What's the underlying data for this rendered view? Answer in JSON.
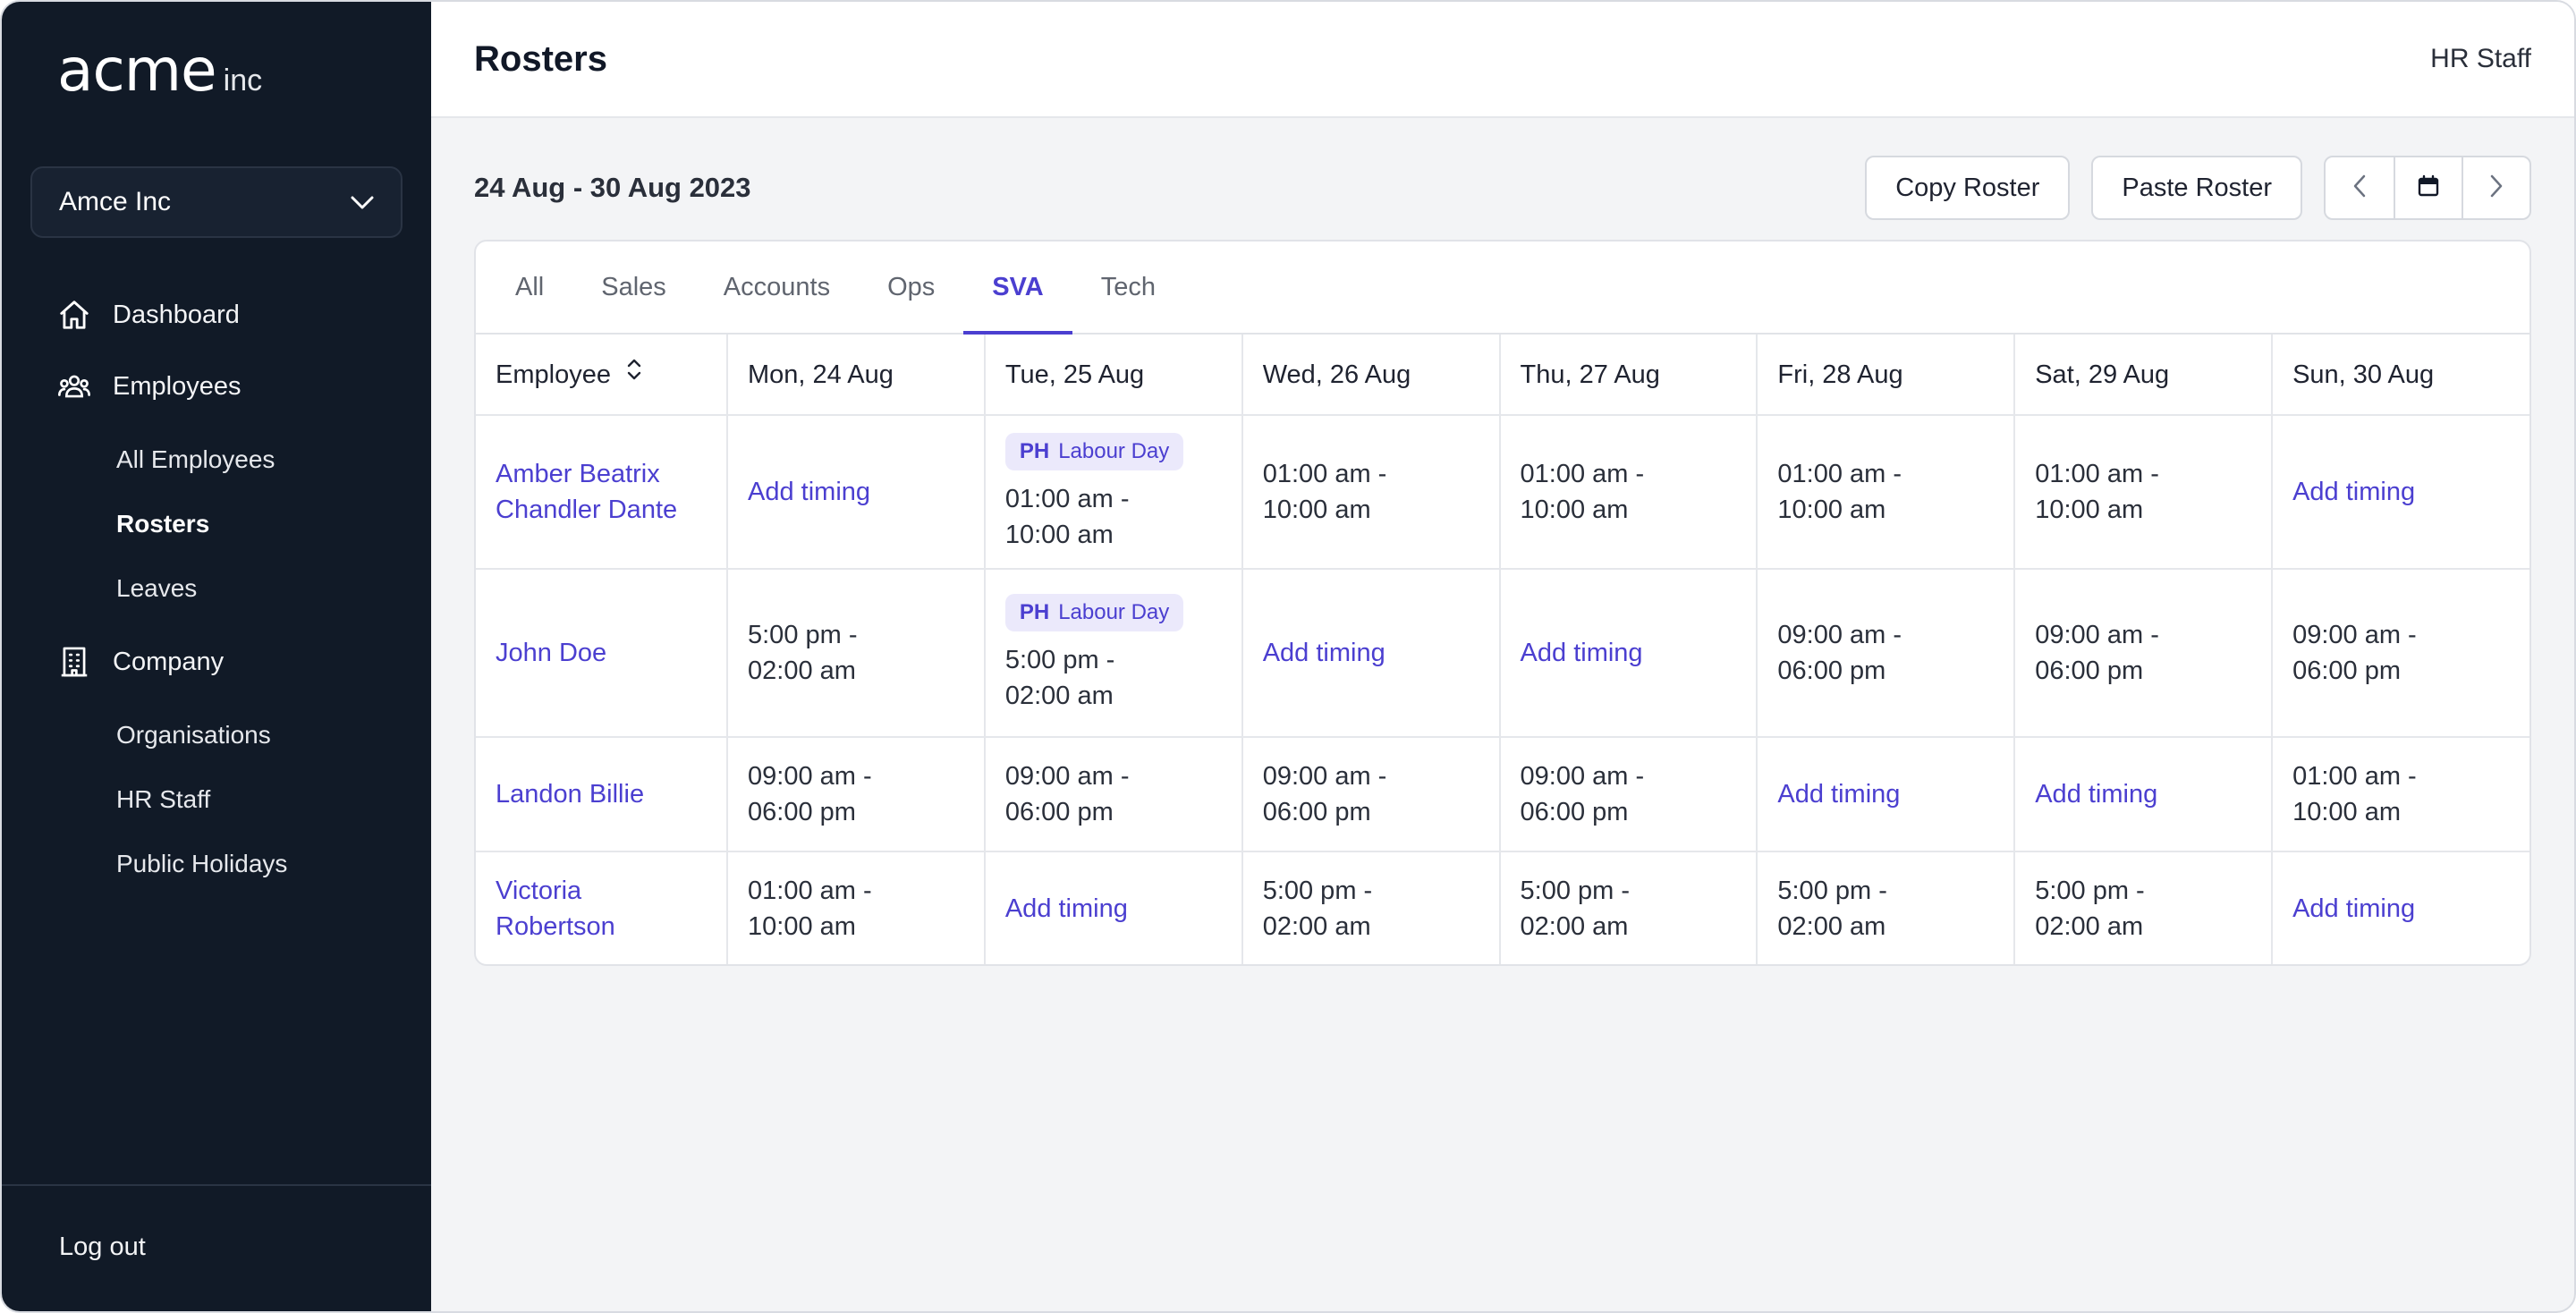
{
  "brand": {
    "name": "acme",
    "suffix": "inc"
  },
  "org_select": {
    "value": "Amce Inc"
  },
  "nav": {
    "dashboard": "Dashboard",
    "employees": "Employees",
    "employees_sub": [
      "All Employees",
      "Rosters",
      "Leaves"
    ],
    "company": "Company",
    "company_sub": [
      "Organisations",
      "HR Staff",
      "Public Holidays"
    ],
    "logout": "Log out"
  },
  "header": {
    "title": "Rosters",
    "user_role": "HR Staff"
  },
  "toolbar": {
    "date_range": "24 Aug - 30 Aug 2023",
    "copy_label": "Copy Roster",
    "paste_label": "Paste Roster"
  },
  "tabs": [
    "All",
    "Sales",
    "Accounts",
    "Ops",
    "SVA",
    "Tech"
  ],
  "active_tab": "SVA",
  "table": {
    "employee_header": "Employee",
    "days": [
      "Mon, 24 Aug",
      "Tue, 25 Aug",
      "Wed, 26 Aug",
      "Thu, 27 Aug",
      "Fri, 28 Aug",
      "Sat, 29 Aug",
      "Sun, 30 Aug"
    ],
    "add_label": "Add timing",
    "holiday": {
      "tag": "PH",
      "name": "Labour Day"
    },
    "rows": [
      {
        "name": [
          "Amber Beatrix",
          "Chandler Dante"
        ],
        "cells": [
          {
            "add": true
          },
          {
            "start": "01:00 am -",
            "end": "10:00 am",
            "holiday": true
          },
          {
            "start": "01:00 am -",
            "end": "10:00 am"
          },
          {
            "start": "01:00 am -",
            "end": "10:00 am"
          },
          {
            "start": "01:00 am -",
            "end": "10:00 am"
          },
          {
            "start": "01:00 am -",
            "end": "10:00 am"
          },
          {
            "add": true
          }
        ]
      },
      {
        "name": [
          "John Doe"
        ],
        "cells": [
          {
            "start": "5:00 pm -",
            "end": "02:00 am"
          },
          {
            "start": "5:00 pm -",
            "end": "02:00 am",
            "holiday": true
          },
          {
            "add": true
          },
          {
            "add": true
          },
          {
            "start": "09:00 am -",
            "end": "06:00 pm"
          },
          {
            "start": "09:00 am -",
            "end": "06:00 pm"
          },
          {
            "start": "09:00 am -",
            "end": "06:00 pm"
          }
        ]
      },
      {
        "name": [
          "Landon Billie"
        ],
        "cells": [
          {
            "start": "09:00 am -",
            "end": "06:00 pm"
          },
          {
            "start": "09:00 am -",
            "end": "06:00 pm"
          },
          {
            "start": "09:00 am -",
            "end": "06:00 pm"
          },
          {
            "start": "09:00 am -",
            "end": "06:00 pm"
          },
          {
            "add": true
          },
          {
            "add": true
          },
          {
            "start": "01:00 am -",
            "end": "10:00 am"
          }
        ]
      },
      {
        "name": [
          "Victoria",
          "Robertson"
        ],
        "cells": [
          {
            "start": "01:00 am -",
            "end": "10:00 am"
          },
          {
            "add": true
          },
          {
            "start": "5:00 pm -",
            "end": "02:00 am"
          },
          {
            "start": "5:00 pm -",
            "end": "02:00 am"
          },
          {
            "start": "5:00 pm -",
            "end": "02:00 am"
          },
          {
            "start": "5:00 pm -",
            "end": "02:00 am"
          },
          {
            "add": true
          }
        ]
      }
    ]
  },
  "colors": {
    "accent": "#4b3fd0",
    "sidebar_bg": "#111a27",
    "badge_bg": "#ebe9fb"
  }
}
